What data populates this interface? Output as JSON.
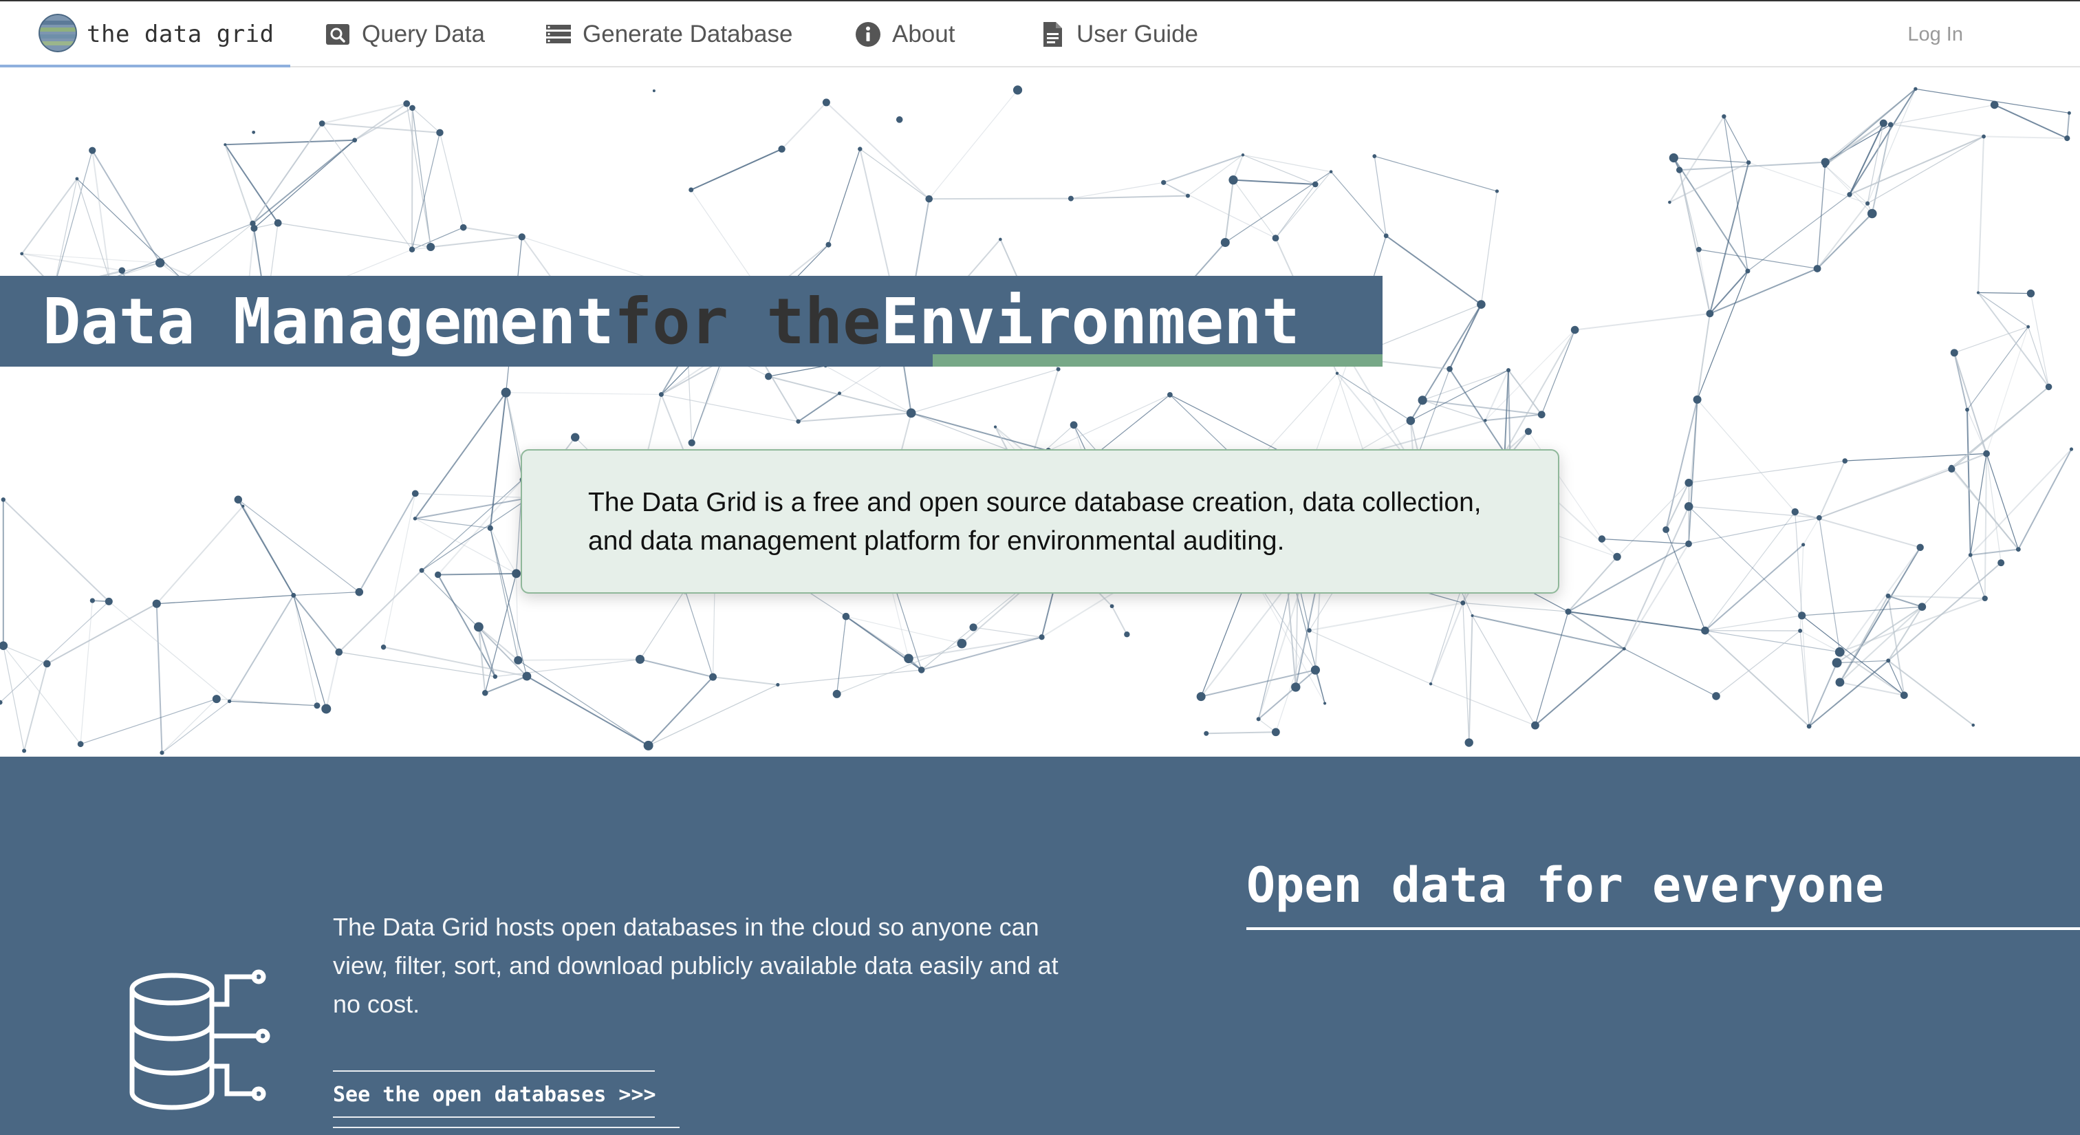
{
  "nav": {
    "brand": {
      "name": "the data grid",
      "logo": "globe-icon"
    },
    "items": [
      {
        "label": "Query Data",
        "icon": "search-icon"
      },
      {
        "label": "Generate Database",
        "icon": "database-list-icon"
      },
      {
        "label": "About",
        "icon": "info-icon"
      },
      {
        "label": "User Guide",
        "icon": "document-icon"
      }
    ],
    "login_label": "Log In"
  },
  "hero": {
    "title_parts": [
      "Data Management",
      "for the",
      "Environment"
    ],
    "description": "The Data Grid is a free and open source database creation, data collection, and data management platform for environmental auditing."
  },
  "open_data": {
    "icon": "database-network-icon",
    "body": "The Data Grid hosts open databases in the cloud so anyone can view, filter, sort, and download publicly available data easily and at no cost.",
    "link_label": "See the open databases >>>",
    "heading": "Open data for everyone"
  },
  "colors": {
    "brand_blue": "#4a6783",
    "accent_green": "#77a887",
    "panel_green": "#e6efe9",
    "nav_active": "#8fb0de"
  }
}
